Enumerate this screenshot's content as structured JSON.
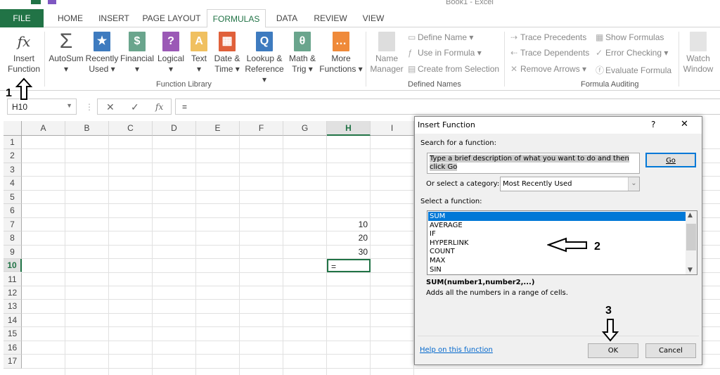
{
  "window": {
    "title": "Book1 - Excel"
  },
  "tabs": [
    "FILE",
    "HOME",
    "INSERT",
    "PAGE LAYOUT",
    "FORMULAS",
    "DATA",
    "REVIEW",
    "VIEW"
  ],
  "active_tab": "FORMULAS",
  "ribbon": {
    "insert_function": [
      "Insert",
      "Function"
    ],
    "library": [
      {
        "l1": "AutoSum",
        "l2": "▾",
        "icon": "sigma-icon",
        "color": "#555555",
        "glyph": "Σ"
      },
      {
        "l1": "Recently",
        "l2": "Used ▾",
        "icon": "star-book-icon",
        "color": "#3e7bbf",
        "glyph": "★"
      },
      {
        "l1": "Financial",
        "l2": "▾",
        "icon": "coins-book-icon",
        "color": "#6aa58d",
        "glyph": "$"
      },
      {
        "l1": "Logical",
        "l2": "▾",
        "icon": "question-book-icon",
        "color": "#9b59b6",
        "glyph": "?"
      },
      {
        "l1": "Text",
        "l2": "▾",
        "icon": "text-book-icon",
        "color": "#f0c060",
        "glyph": "A"
      },
      {
        "l1": "Date &",
        "l2": "Time ▾",
        "icon": "calendar-book-icon",
        "color": "#e0603a",
        "glyph": "▦"
      },
      {
        "l1": "Lookup &",
        "l2": "Reference ▾",
        "icon": "magnifier-book-icon",
        "color": "#3e7bbf",
        "glyph": "Q"
      },
      {
        "l1": "Math &",
        "l2": "Trig ▾",
        "icon": "theta-book-icon",
        "color": "#6aa58d",
        "glyph": "θ"
      },
      {
        "l1": "More",
        "l2": "Functions ▾",
        "icon": "more-book-icon",
        "color": "#ef8a3a",
        "glyph": "…"
      }
    ],
    "library_label": "Function Library",
    "name_manager": [
      "Name",
      "Manager"
    ],
    "defined_names": [
      "Define Name  ▾",
      "Use in Formula ▾",
      "Create from Selection"
    ],
    "defined_names_label": "Defined Names",
    "auditing_col1": [
      "Trace Precedents",
      "Trace Dependents",
      "Remove Arrows  ▾"
    ],
    "auditing_col2": [
      "Show Formulas",
      "Error Checking  ▾",
      "Evaluate Formula"
    ],
    "watch_window": [
      "Watch",
      "Window"
    ],
    "auditing_label": "Formula Auditing"
  },
  "formula_bar": {
    "name_box": "H10",
    "cancel": "✕",
    "enter": "✓",
    "fx": "fx",
    "formula": "="
  },
  "sheet": {
    "columns": [
      "A",
      "B",
      "C",
      "D",
      "E",
      "F",
      "G",
      "H",
      "I"
    ],
    "rows": [
      "1",
      "2",
      "3",
      "4",
      "5",
      "6",
      "7",
      "8",
      "9",
      "10",
      "11",
      "12",
      "13",
      "14",
      "15",
      "16",
      "17"
    ],
    "cells": [
      {
        "col": "H",
        "row": 7,
        "value": "10"
      },
      {
        "col": "H",
        "row": 8,
        "value": "20"
      },
      {
        "col": "H",
        "row": 9,
        "value": "30"
      },
      {
        "col": "H",
        "row": 10,
        "value": "="
      }
    ],
    "active_cell": "H10"
  },
  "dialog": {
    "title": "Insert Function",
    "help": "?",
    "close": "✕",
    "search_label": "Search for a function:",
    "search_value": "Type a brief description of what you want to do and then click Go",
    "go": "Go",
    "category_label": "Or select a category:",
    "category_value": "Most Recently Used",
    "select_label": "Select a function:",
    "functions": [
      "SUM",
      "AVERAGE",
      "IF",
      "HYPERLINK",
      "COUNT",
      "MAX",
      "SIN"
    ],
    "selected": "SUM",
    "signature": "SUM(number1,number2,...)",
    "description": "Adds all the numbers in a range of cells.",
    "help_link": "Help on this function",
    "ok": "OK",
    "cancel": "Cancel"
  },
  "annotations": [
    "1",
    "2",
    "3"
  ],
  "colors": {
    "excel_green": "#217346",
    "selection_blue": "#0078d7",
    "link": "#0066cc"
  }
}
